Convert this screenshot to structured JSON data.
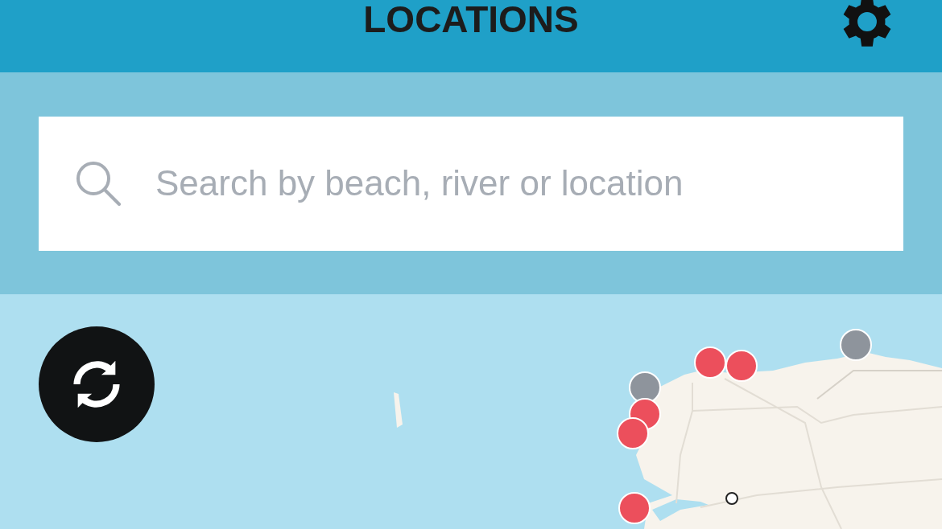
{
  "header": {
    "title": "LOCATIONS"
  },
  "search": {
    "placeholder": "Search by beach, river or location"
  },
  "map": {
    "kind": "picture",
    "markers": [
      {
        "color": "#8e949c"
      },
      {
        "color": "#ec4f5c"
      },
      {
        "color": "#ec4f5c"
      },
      {
        "color": "#8e949c"
      },
      {
        "color": "#ec4f5c"
      },
      {
        "color": "#ec4f5c"
      },
      {
        "color": "#ec4f5c"
      }
    ]
  }
}
